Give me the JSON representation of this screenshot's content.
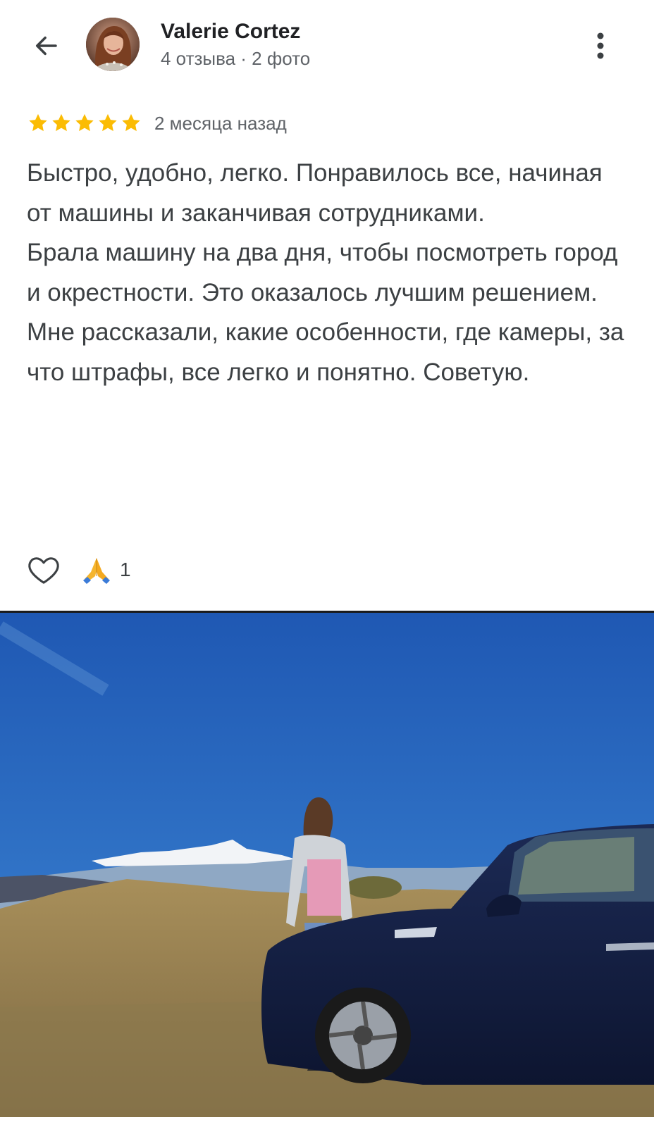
{
  "header": {
    "back_icon": "arrow-left-icon",
    "user_name": "Valerie Cortez",
    "user_meta": "4 отзыва · 2 фото",
    "menu_icon": "more-vertical-icon"
  },
  "review": {
    "rating": 5,
    "rating_max": 5,
    "star_color": "#fbbc04",
    "date": "2 месяца назад",
    "paragraphs": [
      "Быстро, удобно, легко. Понравилось все, начиная от машины и заканчивая сотрудниками.",
      "Брала машину на два дня, чтобы посмотреть город и окрестности. Это оказалось лучшим решением.",
      "Мне рассказали, какие особенности, где камеры, за что штрафы, все легко и понятно. Советую."
    ]
  },
  "actions": {
    "like_icon": "heart-outline-icon",
    "reaction_icon": "folded-hands-icon",
    "reaction_count": "1"
  },
  "photo": {
    "subject": "review-photo"
  }
}
